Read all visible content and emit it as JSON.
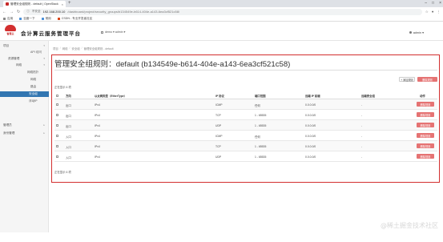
{
  "browser": {
    "tab_title": "管理安全组规则 - default | OpenStack",
    "url_lock": "不安全",
    "url_host": "192.168.200.10",
    "url_path": "/dashboard/project/security_groups/b134549e-b614-404e-a143-6ea3cf521c58/",
    "bookmarks": [
      {
        "icon": "apps-icon",
        "label": "应用"
      },
      {
        "icon": "folder-icon",
        "label": "百度一下"
      },
      {
        "icon": "folder-icon",
        "label": "常用"
      },
      {
        "icon": "csdn-icon",
        "label": "CSDN - 专业开发者社区"
      }
    ]
  },
  "header": {
    "logo_text": "智慧云",
    "app_title": "会计算云服务管理平台",
    "project_label": "demo ▾ admin ▾",
    "user_label": "admin ▾"
  },
  "sidebar": {
    "items": [
      {
        "label": "项目",
        "chev": "▾",
        "level": 0
      },
      {
        "label": "API 访问",
        "chev": "",
        "level": 2
      },
      {
        "label": "资源管理",
        "chev": "▾",
        "level": 1
      },
      {
        "label": "网络",
        "chev": "▾",
        "level": 2
      },
      {
        "label": "网络拓扑",
        "chev": "",
        "level": 3
      },
      {
        "label": "网络",
        "chev": "",
        "level": 3
      },
      {
        "label": "路由",
        "chev": "",
        "level": 3
      },
      {
        "label": "安全组",
        "chev": "",
        "level": 3
      },
      {
        "label": "浮动IP",
        "chev": "",
        "level": 3
      },
      {
        "label": "管理员",
        "chev": "▸",
        "level": 0
      },
      {
        "label": "身份管理",
        "chev": "▸",
        "level": 0
      }
    ],
    "active_index": 7
  },
  "breadcrumb": [
    "项目",
    "网络",
    "安全组",
    "管理安全组规则 - default"
  ],
  "page": {
    "title": "管理安全组规则：default (b134549e-b614-404e-a143-6ea3cf521c58)",
    "add_rule_label": "+ 添加规则",
    "delete_rules_label": "删除规则",
    "count_top": "正在显示 6 项",
    "count_bottom": "正在显示 6 项"
  },
  "table": {
    "headers": [
      "方向",
      "以太网类型（EtherType）",
      "IP 协议",
      "端口范围",
      "远端 IP 前缀",
      "远端安全组",
      "动作"
    ],
    "row_action_label": "删除规则",
    "rows": [
      {
        "direction": "出口",
        "ethertype": "IPv4",
        "protocol": "ICMP",
        "port": "任何",
        "prefix": "0.0.0.0/0",
        "group": "-"
      },
      {
        "direction": "出口",
        "ethertype": "IPv4",
        "protocol": "TCP",
        "port": "1 - 65535",
        "prefix": "0.0.0.0/0",
        "group": "-"
      },
      {
        "direction": "出口",
        "ethertype": "IPv4",
        "protocol": "UDP",
        "port": "1 - 65535",
        "prefix": "0.0.0.0/0",
        "group": "-"
      },
      {
        "direction": "入口",
        "ethertype": "IPv4",
        "protocol": "ICMP",
        "port": "任何",
        "prefix": "0.0.0.0/0",
        "group": "-"
      },
      {
        "direction": "入口",
        "ethertype": "IPv4",
        "protocol": "TCP",
        "port": "1 - 65535",
        "prefix": "0.0.0.0/0",
        "group": "-"
      },
      {
        "direction": "入口",
        "ethertype": "IPv4",
        "protocol": "UDP",
        "port": "1 - 65535",
        "prefix": "0.0.0.0/0",
        "group": "-"
      }
    ]
  },
  "watermark": "@稀土掘金技术社区",
  "colors": {
    "accent_red": "#d32f2f",
    "danger_button": "#e57373",
    "active_nav": "#3276b1"
  }
}
